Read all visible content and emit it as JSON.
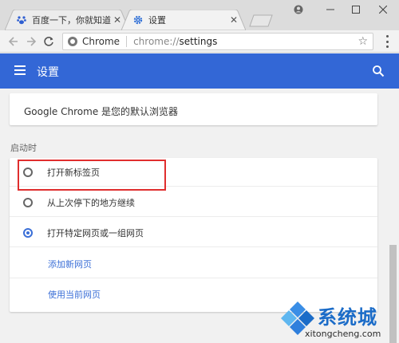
{
  "tabs": [
    {
      "title": "百度一下，你就知道",
      "icon": "baidu-paw-icon",
      "active": false
    },
    {
      "title": "设置",
      "icon": "gear-icon",
      "active": true
    }
  ],
  "toolbar": {
    "url_chip": "Chrome",
    "url_scheme": "chrome://",
    "url_path": "settings"
  },
  "appbar": {
    "title": "设置"
  },
  "default_browser_text": "Google Chrome 是您的默认浏览器",
  "startup": {
    "section_label": "启动时",
    "options": [
      {
        "label": "打开新标签页",
        "checked": false
      },
      {
        "label": "从上次停下的地方继续",
        "checked": false
      },
      {
        "label": "打开特定网页或一组网页",
        "checked": true
      }
    ],
    "links": [
      {
        "label": "添加新网页"
      },
      {
        "label": "使用当前网页"
      }
    ]
  },
  "watermark": {
    "main": "系统城",
    "sub": "xitongcheng.com"
  },
  "colors": {
    "accent": "#3367d6",
    "link": "#3b6fd7",
    "highlight": "#e02e2e"
  }
}
